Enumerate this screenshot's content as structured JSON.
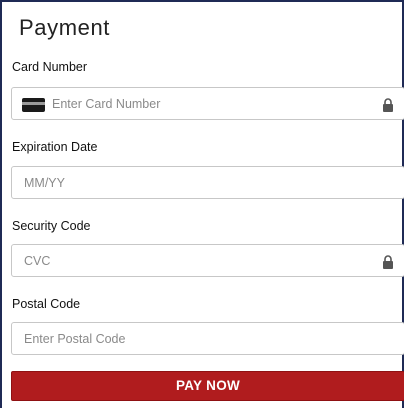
{
  "form": {
    "title": "Payment",
    "fields": [
      {
        "label": "Card Number",
        "placeholder": "Enter Card Number",
        "value": "",
        "icon_left": "credit-card-icon",
        "icon_right": "lock-icon"
      },
      {
        "label": "Expiration Date",
        "placeholder": "MM/YY",
        "value": ""
      },
      {
        "label": "Security Code",
        "placeholder": "CVC",
        "value": "",
        "icon_right": "lock-icon"
      },
      {
        "label": "Postal Code",
        "placeholder": "Enter Postal Code",
        "value": ""
      }
    ],
    "submit_label": "PAY NOW"
  },
  "colors": {
    "button": "#b01c1e",
    "frame_border": "#1f2a55",
    "input_border": "#c7c7c7",
    "placeholder": "#8a8a8a"
  }
}
